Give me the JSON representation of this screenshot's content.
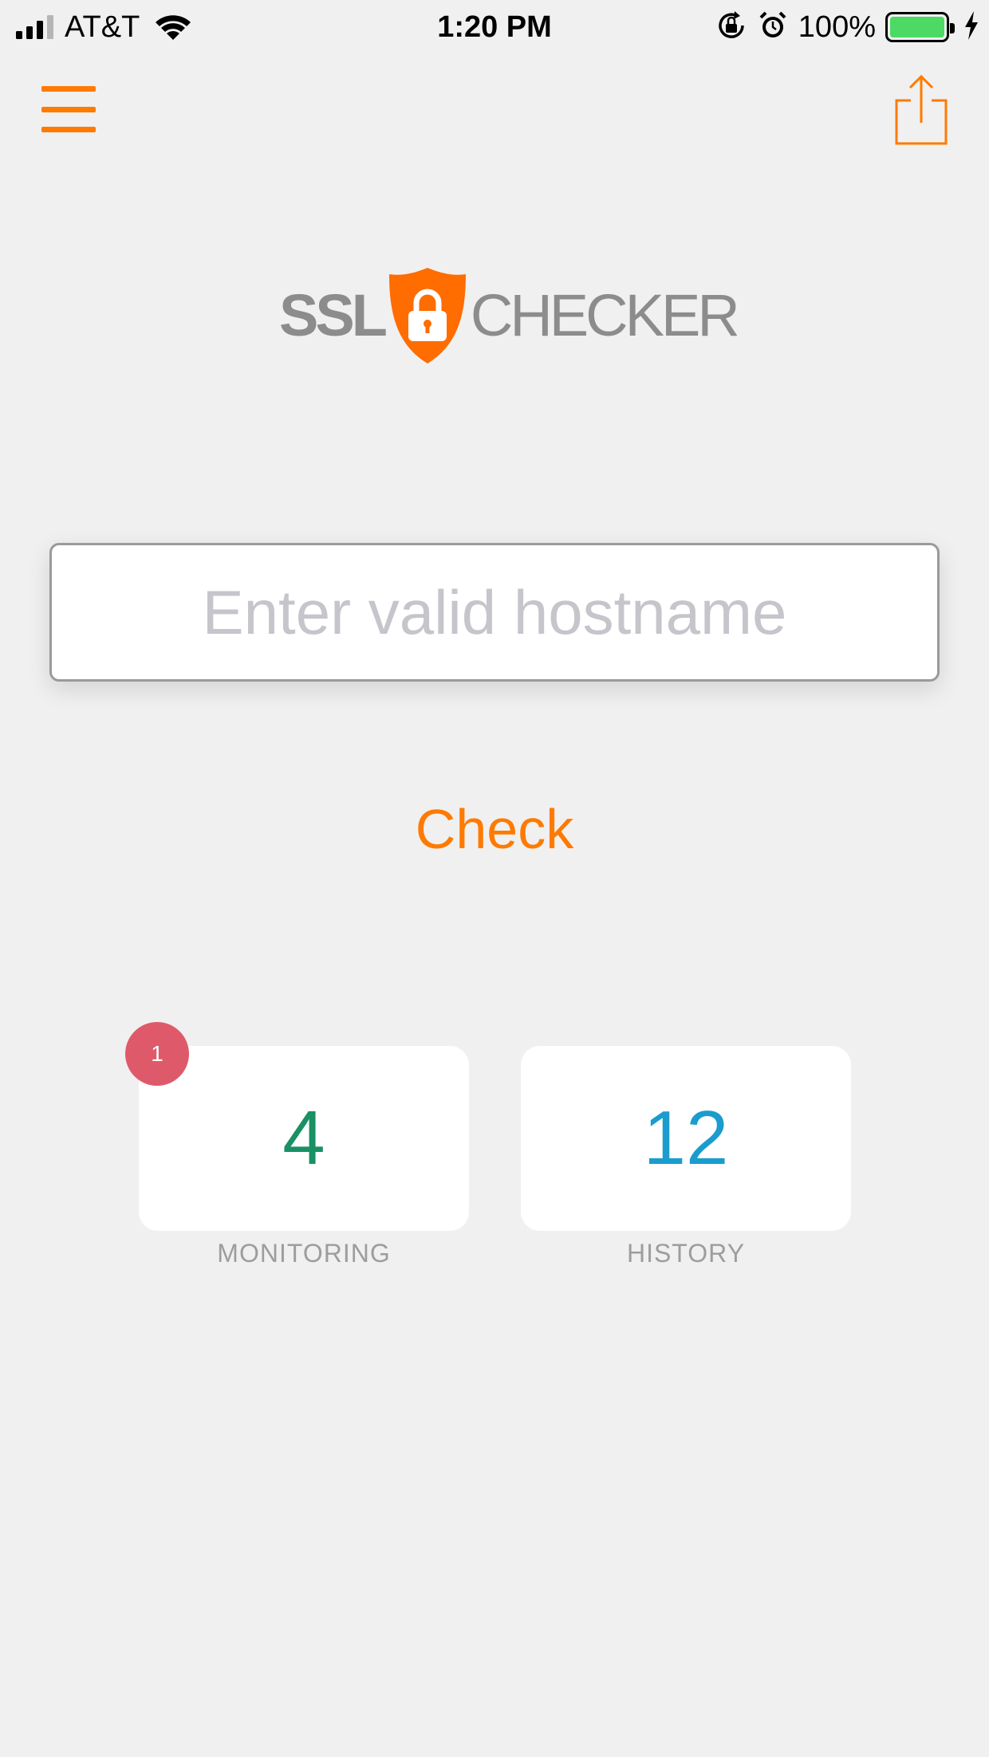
{
  "status_bar": {
    "carrier": "AT&T",
    "time": "1:20 PM",
    "battery_percent": "100%",
    "battery_level": 1.0,
    "signal_bars_filled": 3,
    "signal_bars_total": 4,
    "icons": [
      "signal-icon",
      "wifi-icon",
      "orientation-lock-icon",
      "alarm-icon",
      "battery-icon",
      "charging-bolt-icon"
    ]
  },
  "nav": {
    "menu_icon": "hamburger-menu-icon",
    "share_icon": "share-icon"
  },
  "logo": {
    "left_text": "SSL",
    "right_text": "CHECKER",
    "icon": "shield-lock-icon"
  },
  "search": {
    "value": "",
    "placeholder": "Enter valid hostname"
  },
  "check_label": "Check",
  "stats": {
    "monitoring": {
      "value": "4",
      "label": "MONITORING",
      "badge": "1"
    },
    "history": {
      "value": "12",
      "label": "HISTORY"
    }
  },
  "colors": {
    "accent": "#ff7a00",
    "background": "#f0f0f0",
    "monitoring_value": "#1a9064",
    "history_value": "#1a9ccf",
    "badge": "#de5a6a",
    "battery_fill": "#4cd964"
  }
}
